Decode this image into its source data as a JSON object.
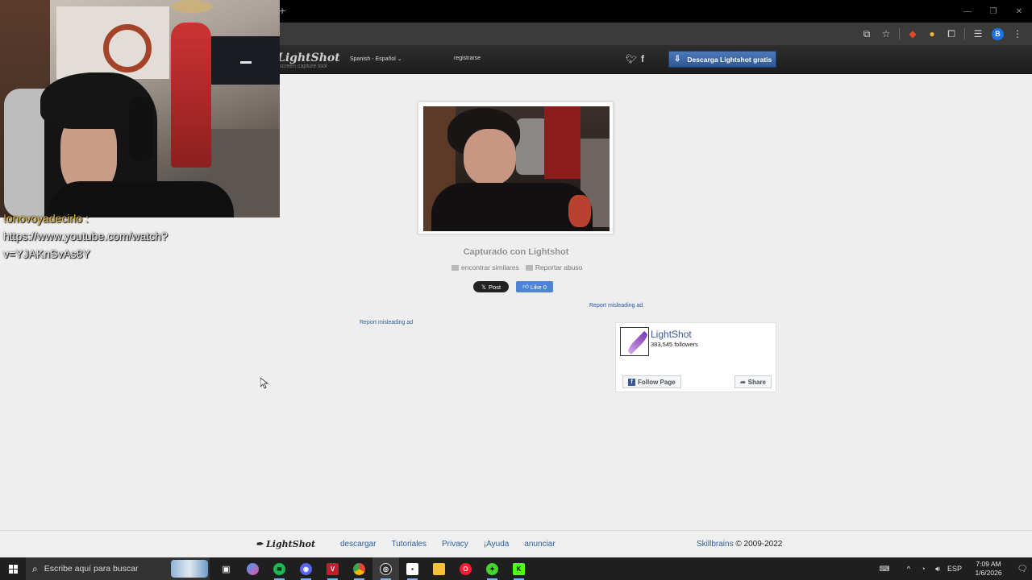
{
  "browser": {
    "new_tab_glyph": "+",
    "window_controls": [
      "—",
      "❐",
      "✕"
    ],
    "toolbar_icons": [
      "cast-icon",
      "star-icon",
      "extension-a-icon",
      "extension-b-icon",
      "puzzle-icon",
      "tab-search-icon",
      "profile-icon",
      "menu-icon"
    ],
    "profile_initial": "B"
  },
  "lightshot_header": {
    "logo": "LightShot",
    "tagline": "screen capture tool",
    "language": "Spanish - Español",
    "register": "registrarse",
    "download_button": "Descarga Lightshot gratis"
  },
  "chat_overlay": {
    "user": "!onovoyadecirlo :",
    "message_line1": "https://www.youtube.com/watch?",
    "message_line2": "v=YJAKnSvAs8Y"
  },
  "capture": {
    "caption": "Capturado con Lightshot",
    "find_similar": "encontrar similares",
    "report_abuse": "Reportar abuso",
    "post_button": "Post",
    "like_button": "Like 0",
    "report_ad_1": "Report misleading ad",
    "report_ad_2": "Report misleading ad"
  },
  "facebook_widget": {
    "page_name": "LightShot",
    "followers": "383,545 followers",
    "follow_label": "Follow Page",
    "share_label": "Share"
  },
  "footer": {
    "logo": "LightShot",
    "links": [
      "descargar",
      "Tutoriales",
      "Privacy",
      "¡Ayuda",
      "anunciar"
    ],
    "company": "Skillbrains",
    "copyright": "© 2009-2022"
  },
  "taskbar": {
    "search_placeholder": "Escribe aquí para buscar",
    "apps": [
      "task-view",
      "copilot",
      "spotify",
      "discord",
      "voicemod",
      "chrome",
      "obs",
      "roblox",
      "file-explorer",
      "opera-gx",
      "razer",
      "kick"
    ],
    "language": "ESP",
    "time": "7:09 AM",
    "date": "1/6/2026"
  },
  "colors": {
    "page_bg": "#eeeeee",
    "header_bg": "#252525",
    "download_button": "#3a65a6",
    "link": "#2f5f9e",
    "taskbar_bg": "#1f1f1f"
  }
}
